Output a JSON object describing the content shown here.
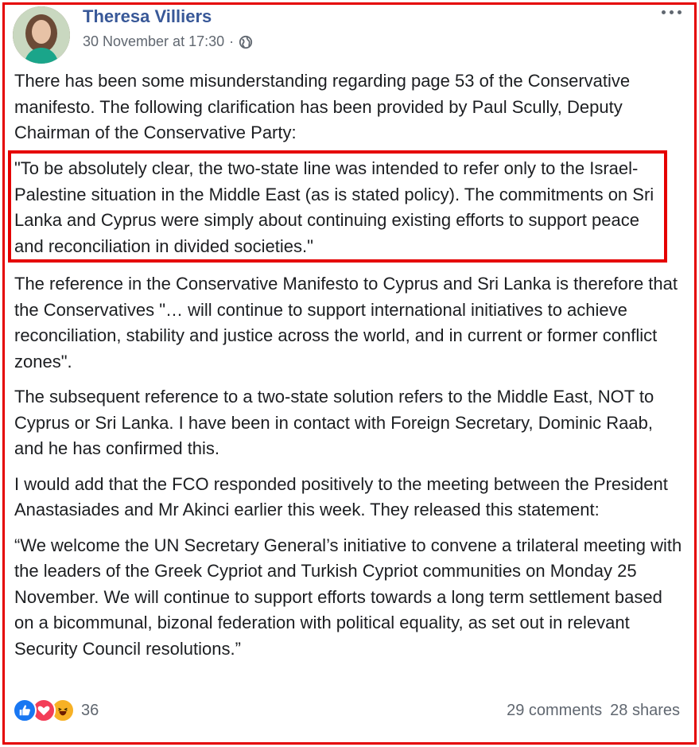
{
  "post": {
    "author": "Theresa Villiers",
    "timestamp": "30 November at 17:30",
    "separator": "·",
    "privacy_icon": "globe-icon",
    "more_icon": "more-options-icon"
  },
  "paragraphs": {
    "p1": "There has been some misunderstanding regarding page 53 of the Conservative manifesto. The following clarification has been provided by Paul Scully, Deputy Chairman of the Conservative Party:",
    "quote": "\"To be absolutely clear, the two-state line was intended to refer only to the Israel-Palestine situation in the Middle East (as is stated policy). The commitments on Sri Lanka and Cyprus were simply about continuing existing efforts to support peace and reconciliation in divided societies.\"",
    "p3": "The reference in the Conservative Manifesto to Cyprus and Sri Lanka is therefore that the Conservatives \"… will continue to support international initiatives to achieve reconciliation, stability and justice across the world, and in current or former conflict zones\".",
    "p4": "The subsequent reference to a two-state solution refers to the Middle East, NOT to Cyprus or Sri Lanka. I have been in contact with Foreign Secretary, Dominic Raab, and he has confirmed this.",
    "p5": "I would add that the FCO responded positively to the meeting between the President Anastasiades and Mr Akinci earlier this week. They released this statement:",
    "p6": "“We welcome the UN Secretary General’s initiative to convene a trilateral meeting with the leaders of the Greek Cypriot and Turkish Cypriot communities on Monday 25 November. We will continue to support efforts towards a long term settlement based on a bicommunal, bizonal federation with political equality, as set out in relevant Security Council resolutions.”"
  },
  "footer": {
    "reaction_count": "36",
    "comments": "29 comments",
    "shares": "28 shares",
    "reactions": [
      "like-icon",
      "love-icon",
      "haha-icon"
    ]
  },
  "colors": {
    "highlight": "#e50000",
    "link": "#385898",
    "like": "#1877f2",
    "love": "#f33e58",
    "haha": "#f7b125"
  }
}
